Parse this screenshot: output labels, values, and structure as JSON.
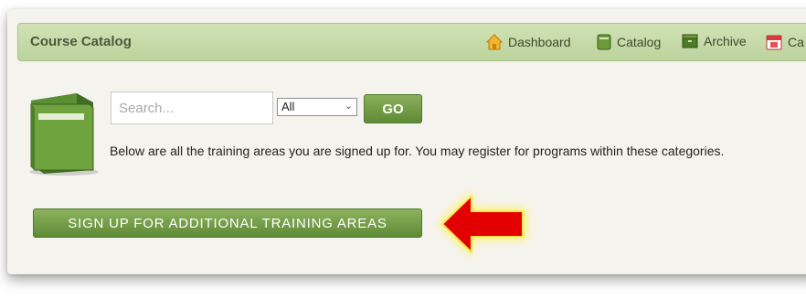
{
  "header": {
    "title": "Course Catalog",
    "nav": [
      {
        "label": "Dashboard",
        "icon": "house-icon"
      },
      {
        "label": "Catalog",
        "icon": "catalog-book-icon"
      },
      {
        "label": "Archive",
        "icon": "archive-icon"
      },
      {
        "label": "Ca",
        "icon": "calendar-icon"
      }
    ]
  },
  "search": {
    "placeholder": "Search...",
    "value": ""
  },
  "filter": {
    "selected": "All"
  },
  "go_button": "GO",
  "description": "Below are all the training areas you are signed up for. You may register for programs within these categories.",
  "signup_button": "SIGN UP FOR ADDITIONAL TRAINING AREAS",
  "colors": {
    "header_bg": "#c8dcaa",
    "button_green": "#6f9a44",
    "arrow_red": "#e00000",
    "panel_bg": "#f5f3ee"
  },
  "icons": {
    "book": "green-book-icon",
    "annotation": "red-arrow-icon"
  }
}
